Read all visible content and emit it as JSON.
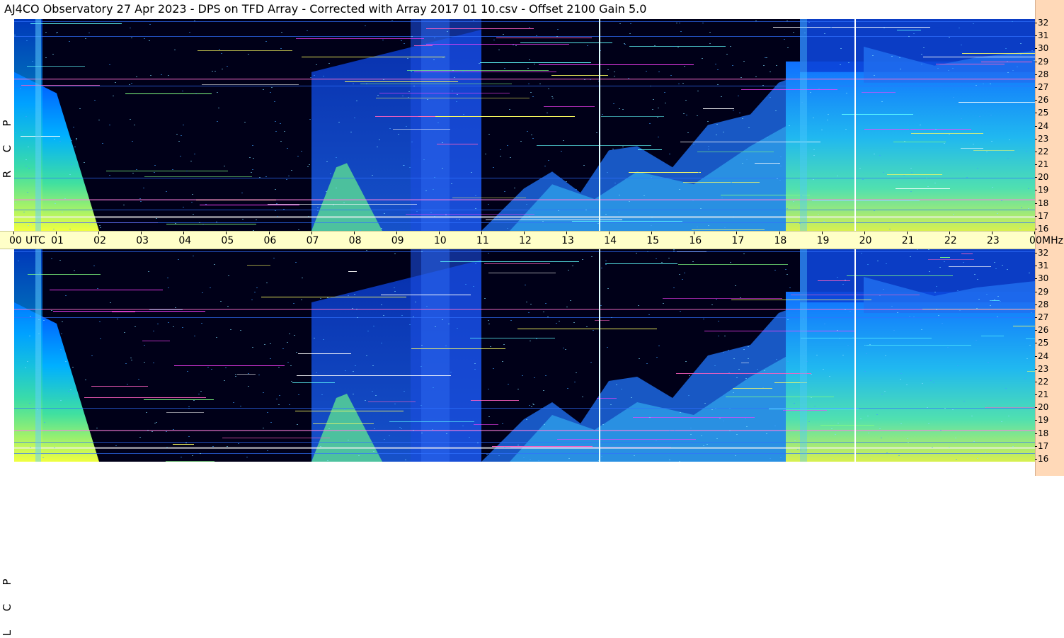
{
  "title": "AJ4CO Observatory  27 Apr 2023  -  DPS on TFD Array  -  Corrected with Array 2017 01 10.csv  -  Offset 2100  Gain 5.0",
  "panels": [
    {
      "id": "rcp",
      "letters": [
        "R",
        "C",
        "P"
      ]
    },
    {
      "id": "lcp",
      "letters": [
        "L",
        "C",
        "P"
      ]
    }
  ],
  "time_axis": {
    "labels": [
      "00",
      "UTC",
      "01",
      "02",
      "03",
      "04",
      "05",
      "06",
      "07",
      "08",
      "09",
      "10",
      "11",
      "12",
      "13",
      "14",
      "15",
      "16",
      "17",
      "18",
      "19",
      "20",
      "21",
      "22",
      "23",
      "00",
      "MHz"
    ],
    "hours": [
      "00",
      "01",
      "02",
      "03",
      "04",
      "05",
      "06",
      "07",
      "08",
      "09",
      "10",
      "11",
      "12",
      "13",
      "14",
      "15",
      "16",
      "17",
      "18",
      "19",
      "20",
      "21",
      "22",
      "23",
      "00"
    ],
    "utc_label": "UTC",
    "unit_label": "MHz"
  },
  "frequency_axis": {
    "labels": [
      "32",
      "31",
      "30",
      "29",
      "28",
      "27",
      "26",
      "25",
      "24",
      "23",
      "22",
      "21",
      "20",
      "19",
      "18",
      "17",
      "16"
    ],
    "range_mhz": [
      16,
      32
    ]
  },
  "colors": {
    "background_dark": "#000020",
    "axis_bar": "#ffffc8",
    "freq_column": "#ffd9b8",
    "low": "#0030ff",
    "mid": "#00c8ff",
    "high": "#f0f040"
  }
}
